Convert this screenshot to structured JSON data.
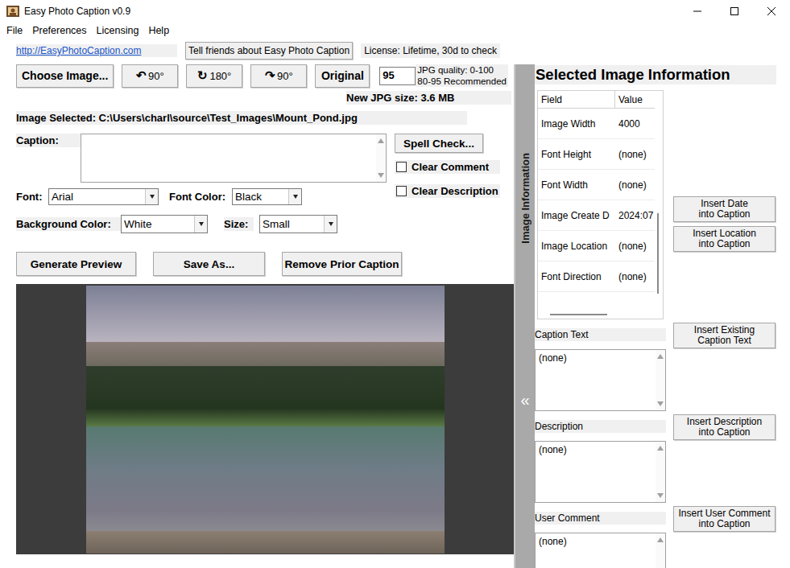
{
  "window": {
    "title": "Easy Photo Caption v0.9"
  },
  "menu": [
    "File",
    "Preferences",
    "Licensing",
    "Help"
  ],
  "top_bar": {
    "link": "http://EasyPhotoCaption.com",
    "share_button": "Tell friends about Easy Photo Caption",
    "license": "License: Lifetime, 30d to check"
  },
  "toolbar": {
    "buttons": [
      {
        "label": "Choose Image...",
        "icon": ""
      },
      {
        "label": "90°",
        "icon": "↶"
      },
      {
        "label": "180°",
        "icon": "↻"
      },
      {
        "label": "90°",
        "icon": "↷"
      },
      {
        "label": "Original",
        "icon": ""
      }
    ],
    "quality_value": "95",
    "quality_hint": [
      "JPG quality: 0-100",
      "80-95 Recommended"
    ],
    "new_size": "New JPG size: 3.6 MB"
  },
  "image_selected": "Image Selected: C:\\Users\\charl\\source\\Test_Images\\Mount_Pond.jpg",
  "caption_label": "Caption:",
  "spell_check": "Spell Check...",
  "checkboxes": [
    {
      "label": "Clear Comment",
      "checked": false
    },
    {
      "label": "Clear Description",
      "checked": false
    }
  ],
  "dropdowns": [
    {
      "label": "Font:",
      "value": "Arial"
    },
    {
      "label": "Font Color:",
      "value": "Black"
    },
    {
      "label": "Background Color:",
      "value": "White"
    },
    {
      "label": "Size:",
      "value": "Small"
    }
  ],
  "actions": [
    "Generate Preview",
    "Save As...",
    "Remove Prior Caption"
  ],
  "splitter": {
    "label": "Image Information",
    "arrow": "«"
  },
  "info": {
    "title": "Selected Image Information",
    "columns": [
      "Field",
      "Value"
    ],
    "rows": [
      {
        "field": "Image Width",
        "value": "4000"
      },
      {
        "field": "Font Height",
        "value": "(none)"
      },
      {
        "field": "Font Width",
        "value": "(none)"
      },
      {
        "field": "Image Create D",
        "value": "2024:07"
      },
      {
        "field": "Image Location",
        "value": "(none)"
      },
      {
        "field": "Font Direction",
        "value": "(none)"
      }
    ]
  },
  "insert_buttons": [
    {
      "lines": [
        "Insert Date",
        "into Caption"
      ]
    },
    {
      "lines": [
        "Insert Location",
        "into Caption"
      ]
    },
    {
      "lines": [
        "Insert Existing",
        "Caption Text"
      ]
    },
    {
      "lines": [
        "Insert Description",
        "into Caption"
      ]
    },
    {
      "lines": [
        "Insert User Comment",
        "into Caption"
      ]
    }
  ],
  "text_fields": [
    {
      "label": "Caption Text",
      "value": "(none)"
    },
    {
      "label": "Description",
      "value": "(none)"
    },
    {
      "label": "User Comment",
      "value": "(none)"
    }
  ]
}
